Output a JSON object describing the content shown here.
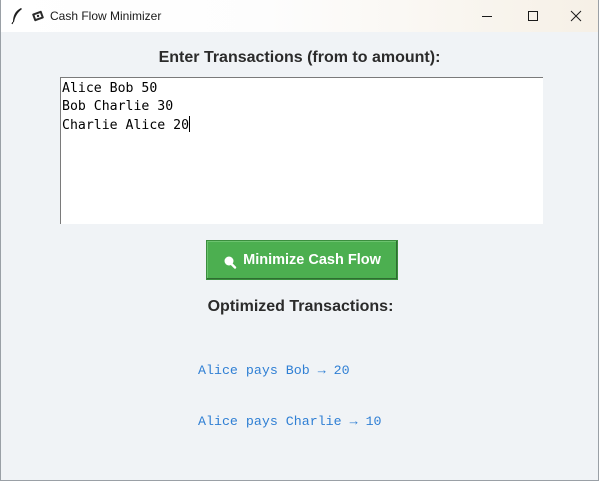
{
  "window": {
    "title": "Cash Flow Minimizer"
  },
  "titlebar_buttons": {
    "minimize_icon": "minimize-icon",
    "maximize_icon": "maximize-icon",
    "close_icon": "close-icon"
  },
  "main": {
    "heading": "Enter Transactions (from to amount):",
    "transactions_lines": [
      "Alice Bob 50",
      "Bob Charlie 30",
      "Charlie Alice 20"
    ],
    "button_icon": "magnifier-icon",
    "button_label": "Minimize Cash Flow",
    "button_color": "#4caf50",
    "results_heading": "Optimized Transactions:",
    "results": [
      "Alice pays Bob → 20",
      "Alice pays Charlie → 10"
    ],
    "results_color": "#2f7fd4"
  }
}
